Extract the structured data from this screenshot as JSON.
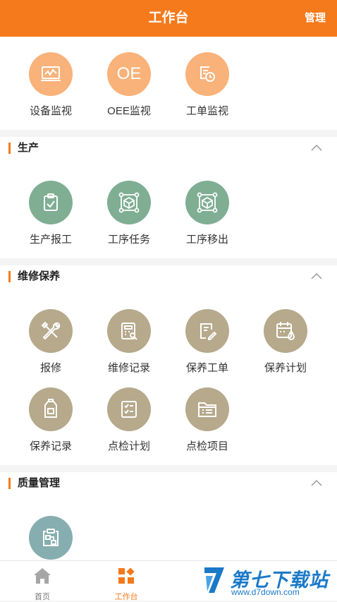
{
  "header": {
    "title": "工作台",
    "manage_label": "管理"
  },
  "top_tiles": [
    {
      "label": "设备监视",
      "icon": "monitor-chart-icon"
    },
    {
      "label": "OEE监视",
      "icon_text": "OE",
      "icon": "oee-icon"
    },
    {
      "label": "工单监视",
      "icon": "order-clock-icon"
    }
  ],
  "sections": {
    "production": {
      "title": "生产",
      "items": [
        {
          "label": "生产报工",
          "icon": "clipboard-check-icon"
        },
        {
          "label": "工序任务",
          "icon": "box-network-icon"
        },
        {
          "label": "工序移出",
          "icon": "box-network-icon"
        }
      ]
    },
    "maintenance": {
      "title": "维修保养",
      "items": [
        {
          "label": "报修",
          "icon": "tools-icon"
        },
        {
          "label": "维修记录",
          "icon": "calculator-doc-icon"
        },
        {
          "label": "保养工单",
          "icon": "doc-pen-icon"
        },
        {
          "label": "保养计划",
          "icon": "calendar-drop-icon"
        },
        {
          "label": "保养记录",
          "icon": "oil-can-icon"
        },
        {
          "label": "点检计划",
          "icon": "checklist-icon"
        },
        {
          "label": "点检项目",
          "icon": "folder-list-icon"
        }
      ]
    },
    "quality": {
      "title": "质量管理",
      "items": [
        {
          "label": "",
          "icon": "clipboard-flow-icon"
        }
      ]
    }
  },
  "tabbar": {
    "items": [
      {
        "label": "首页",
        "icon": "home-icon"
      },
      {
        "label": "工作台",
        "icon": "workbench-icon",
        "active": true
      }
    ]
  },
  "watermark": {
    "title": "第七下载站",
    "url": "www.d7down.com"
  },
  "colors": {
    "accent": "#f47a1c",
    "orange_circle": "#f9b27a",
    "green_circle": "#7fae93",
    "khaki_circle": "#b6a98c",
    "teal_circle": "#86aeb0"
  }
}
